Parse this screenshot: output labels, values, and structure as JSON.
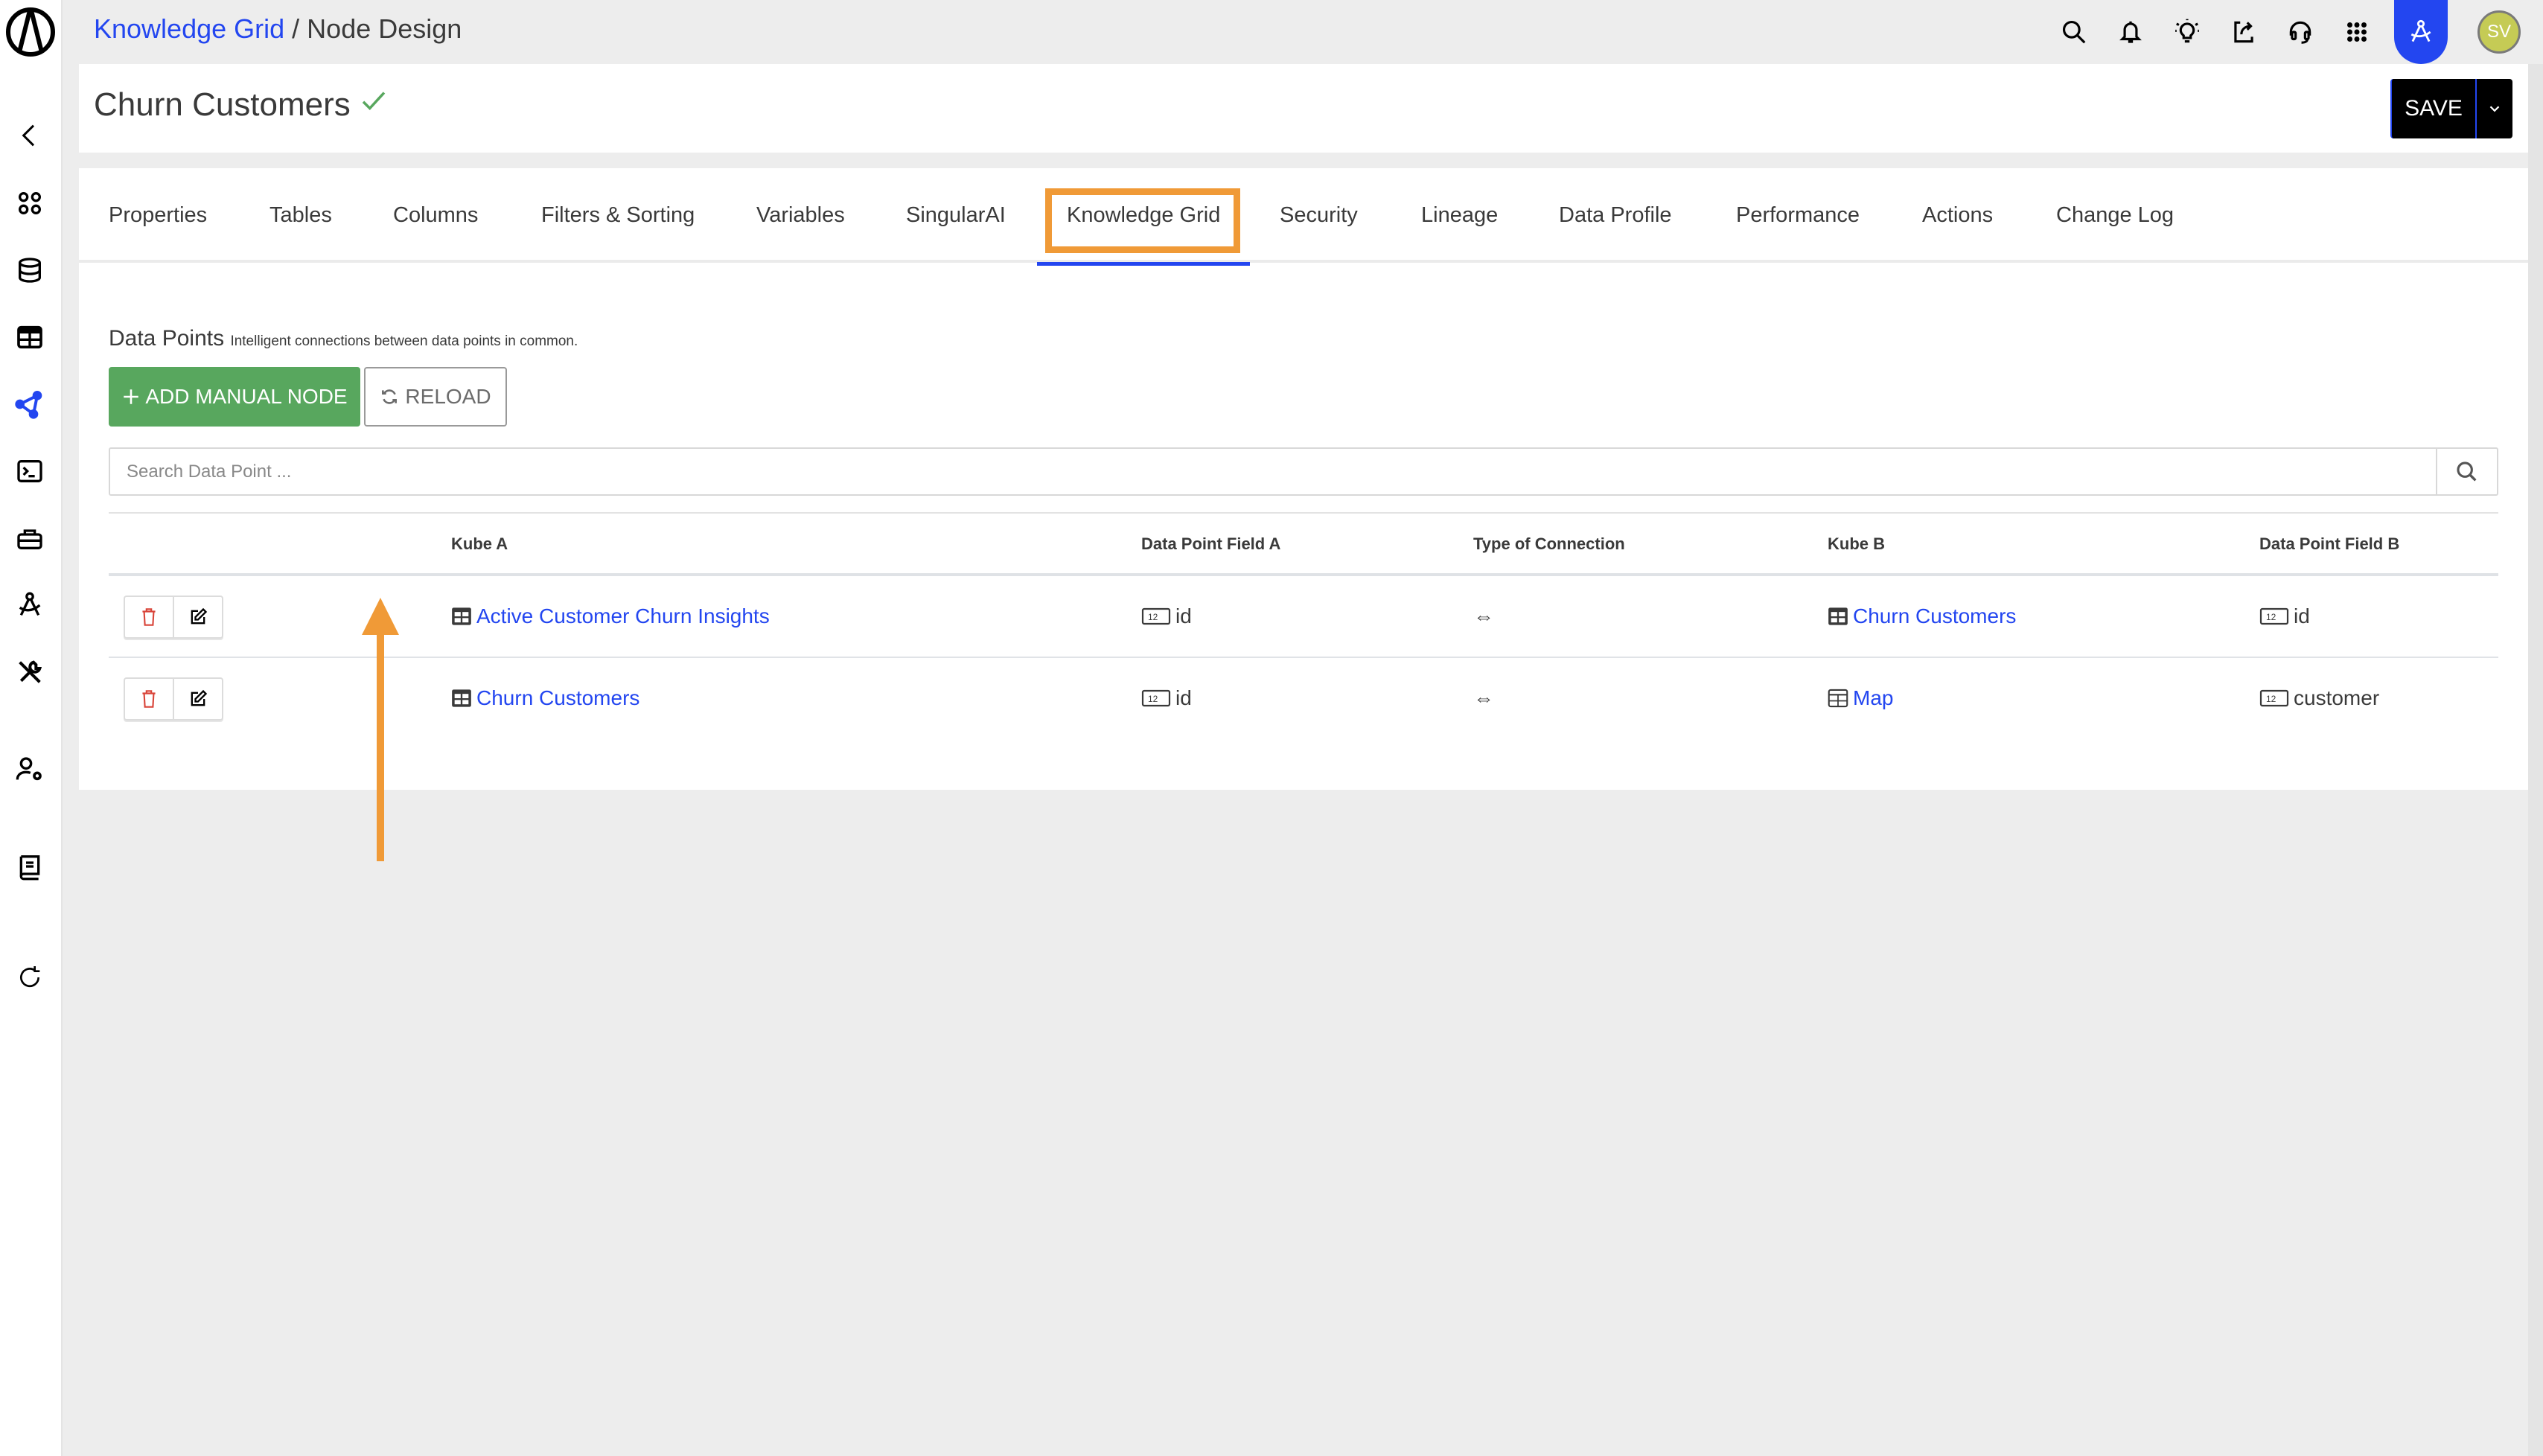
{
  "topbar": {
    "breadcrumb": {
      "parent": "Knowledge Grid",
      "separator": " / ",
      "current": "Node Design"
    },
    "icons": [
      "search-icon",
      "bell-icon",
      "lightbulb-icon",
      "share-icon",
      "headset-icon",
      "apps-grid-icon",
      "compass-icon"
    ],
    "avatar_initials": "SV"
  },
  "sidebar": {
    "items": [
      {
        "name": "collapse",
        "icon": "chevron-left-icon"
      },
      {
        "name": "dashboard",
        "icon": "dots-grid-icon"
      },
      {
        "name": "database",
        "icon": "database-icon"
      },
      {
        "name": "tables",
        "icon": "table-icon"
      },
      {
        "name": "knowledge-grid",
        "icon": "network-icon",
        "active": true
      },
      {
        "name": "terminal",
        "icon": "terminal-icon"
      },
      {
        "name": "toolbox",
        "icon": "toolbox-icon"
      },
      {
        "name": "design",
        "icon": "compass-icon"
      },
      {
        "name": "tools",
        "icon": "tools-icon"
      },
      {
        "name": "user-settings",
        "icon": "user-gear-icon"
      },
      {
        "name": "docs",
        "icon": "book-icon"
      },
      {
        "name": "refresh",
        "icon": "refresh-icon"
      }
    ]
  },
  "header": {
    "title": "Churn Customers",
    "save_label": "SAVE"
  },
  "tabs": [
    {
      "label": "Properties"
    },
    {
      "label": "Tables"
    },
    {
      "label": "Columns"
    },
    {
      "label": "Filters & Sorting"
    },
    {
      "label": "Variables"
    },
    {
      "label": "SingularAI"
    },
    {
      "label": "Knowledge Grid",
      "active": true
    },
    {
      "label": "Security"
    },
    {
      "label": "Lineage"
    },
    {
      "label": "Data Profile"
    },
    {
      "label": "Performance"
    },
    {
      "label": "Actions"
    },
    {
      "label": "Change Log"
    }
  ],
  "data_points": {
    "title": "Data Points",
    "subtitle": "Intelligent connections between data points in common.",
    "add_button": "ADD MANUAL NODE",
    "reload_button": "RELOAD",
    "search_placeholder": "Search Data Point ..."
  },
  "table": {
    "columns": [
      "",
      "Kube A",
      "Data Point Field A",
      "Type of Connection",
      "Kube B",
      "Data Point Field B"
    ],
    "rows": [
      {
        "kube_a": "Active Customer Churn Insights",
        "field_a": "id",
        "connection": "⇔",
        "kube_b": "Churn Customers",
        "field_b": "id"
      },
      {
        "kube_a": "Churn Customers",
        "field_a": "id",
        "connection": "⇔",
        "kube_b": "Map",
        "field_b": "customer"
      }
    ]
  },
  "colors": {
    "accent_blue": "#2346f0",
    "add_green": "#58a75e",
    "highlight_orange": "#f09a37",
    "delete_red": "#d9453a",
    "avatar": "#c5cb55"
  }
}
